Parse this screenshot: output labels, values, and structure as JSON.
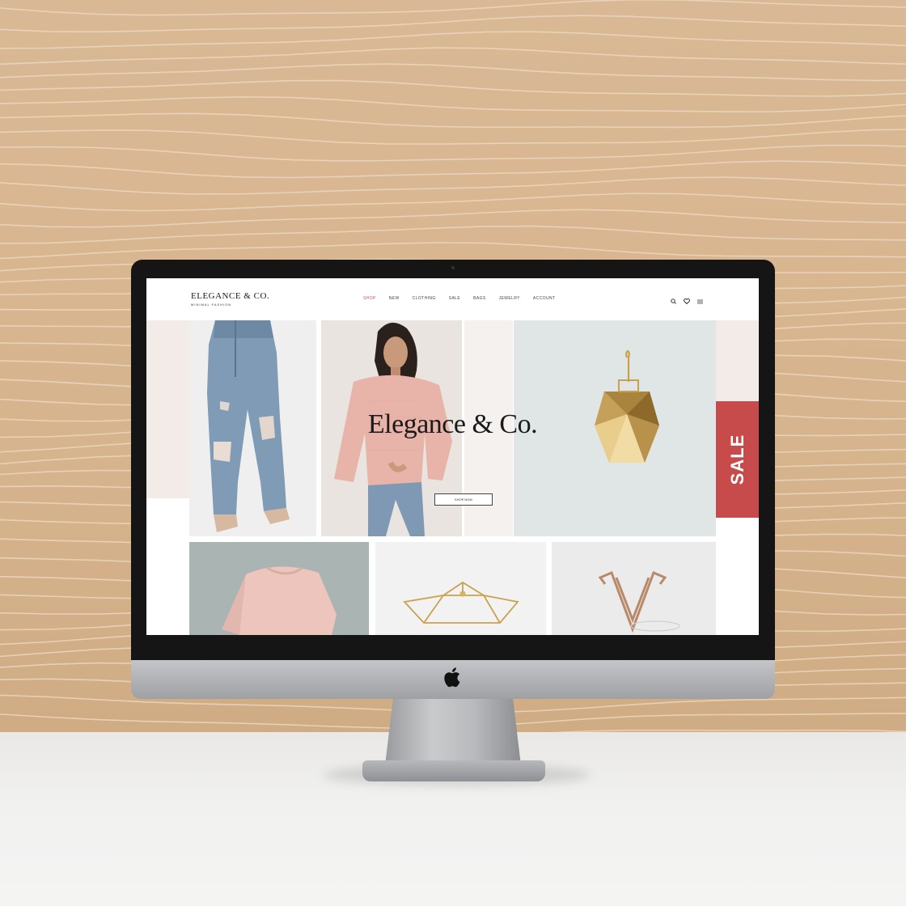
{
  "site": {
    "logo": "ELEGANCE & CO.",
    "tagline": "MINIMAL FASHION",
    "nav": [
      "SHOP",
      "NEW",
      "CLOTHING",
      "SALE",
      "BAGS",
      "JEWELRY",
      "ACCOUNT"
    ],
    "icons": [
      "search-icon",
      "heart-icon",
      "menu-icon"
    ]
  },
  "hero": {
    "title": "Elegance & Co.",
    "button_label": "SHOP NOW",
    "sale_label": "SALE"
  },
  "products": [
    {
      "name": "pink-sweater"
    },
    {
      "name": "gold-bracelet"
    },
    {
      "name": "geometric-ring"
    }
  ],
  "colors": {
    "accent": "#c84b4b",
    "wall": "#d8b893",
    "text": "#1a1a1a"
  }
}
